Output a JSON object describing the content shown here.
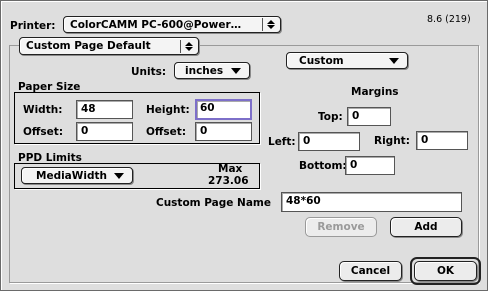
{
  "printer": {
    "label": "Printer:",
    "value": "ColorCAMM PC-600@Power…"
  },
  "version": "8.6 (219)",
  "page_size_popup": "Custom Page Default",
  "units": {
    "label": "Units:",
    "value": "inches"
  },
  "paper_size": {
    "title": "Paper Size",
    "width_label": "Width:",
    "width_value": "48",
    "height_label": "Height:",
    "height_value": "60",
    "offset1_label": "Offset:",
    "offset1_value": "0",
    "offset2_label": "Offset:",
    "offset2_value": "0"
  },
  "ppd_limits": {
    "title": "PPD Limits",
    "selected": "MediaWidth",
    "max_label": "Max",
    "max_value": "273.06"
  },
  "margins": {
    "preset": "Custom",
    "title": "Margins",
    "top_label": "Top:",
    "top_value": "0",
    "left_label": "Left:",
    "left_value": "0",
    "right_label": "Right:",
    "right_value": "0",
    "bottom_label": "Bottom:",
    "bottom_value": "0"
  },
  "custom_page_name": {
    "label": "Custom Page Name",
    "value": "48*60"
  },
  "buttons": {
    "remove": "Remove",
    "add": "Add",
    "cancel": "Cancel",
    "ok": "OK"
  }
}
